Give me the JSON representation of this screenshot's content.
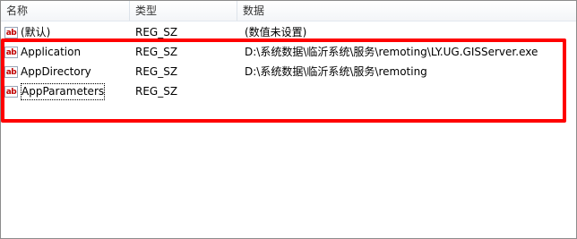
{
  "columns": {
    "name": "名称",
    "type": "类型",
    "data": "数据"
  },
  "rows": [
    {
      "icon": "string-value-icon",
      "icon_text": "ab",
      "name": "(默认)",
      "type": "REG_SZ",
      "data": "(数值未设置)"
    },
    {
      "icon": "string-value-icon",
      "icon_text": "ab",
      "name": "Application",
      "type": "REG_SZ",
      "data": "D:\\系统数据\\临沂系统\\服务\\remoting\\LY.UG.GISServer.exe"
    },
    {
      "icon": "string-value-icon",
      "icon_text": "ab",
      "name": "AppDirectory",
      "type": "REG_SZ",
      "data": "D:\\系统数据\\临沂系统\\服务\\remoting"
    },
    {
      "icon": "string-value-icon",
      "icon_text": "ab",
      "name": "AppParameters",
      "type": "REG_SZ",
      "data": ""
    }
  ],
  "colors": {
    "highlight": "#ff0000",
    "icon_text": "#c00000"
  }
}
